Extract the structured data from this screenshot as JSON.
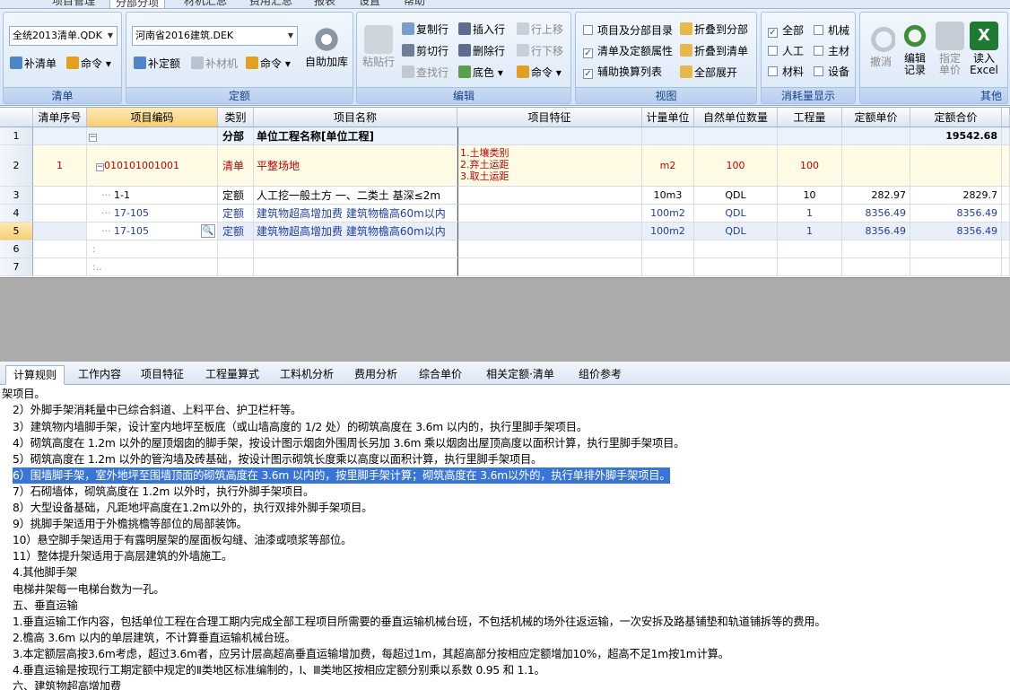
{
  "menu": {
    "items": [
      "项目管理",
      "分部分项",
      "材机汇总",
      "费用汇总",
      "报表",
      "设置",
      "帮助"
    ],
    "active": 1
  },
  "ribbon": {
    "g_qingdan": {
      "title": "清单",
      "combo": "全统2013清单.QDK",
      "btn1": "补清单",
      "btn2": "命令"
    },
    "g_dinge": {
      "title": "定额",
      "combo": "河南省2016建筑.DEK",
      "btn1": "补定额",
      "btn2": "补材机",
      "btn3": "命令",
      "big": "自助加库"
    },
    "g_edit": {
      "title": "编辑",
      "paste": "粘贴行",
      "copy": "复制行",
      "cut": "剪切行",
      "find": "查找行",
      "insert": "插入行",
      "delete": "删除行",
      "bg": "底色",
      "up": "行上移",
      "down": "行下移",
      "cmd": "命令"
    },
    "g_view": {
      "title": "视图",
      "c1": "项目及分部目录",
      "c2": "清单及定额属性",
      "c3": "辅助换算列表",
      "b1": "折叠到分部",
      "b2": "折叠到清单",
      "b3": "全部展开"
    },
    "g_consume": {
      "title": "消耗量显示",
      "c1": "全部",
      "c2": "机械",
      "c3": "人工",
      "c4": "主材",
      "c5": "材料",
      "c6": "设备"
    },
    "g_other": {
      "title": "其他",
      "undo": "撤消",
      "edit_l1": "编辑",
      "edit_l2": "记录",
      "price_l1": "指定",
      "price_l2": "单价",
      "read_l1": "读入",
      "read_l2": "Excel"
    }
  },
  "grid": {
    "headers": [
      "清单序号",
      "项目编码",
      "类别",
      "项目名称",
      "项目特征",
      "计量单位",
      "自然单位数量",
      "工程量",
      "定额单价",
      "定额合价"
    ],
    "rows": [
      {
        "n": "1",
        "seq": "",
        "code": "",
        "type": "分部",
        "name": "单位工程名称[单位工程]",
        "feature": "",
        "unit": "",
        "nat": "",
        "qty": "",
        "price": "",
        "total": "19542.68"
      },
      {
        "n": "2",
        "seq": "1",
        "code": "010101001001",
        "type": "清单",
        "name": "平整场地",
        "feature": [
          "1.土壤类别",
          "2.弃土运距",
          "3.取土运距"
        ],
        "unit": "m2",
        "nat": "100",
        "qty": "100",
        "price": "",
        "total": ""
      },
      {
        "n": "3",
        "seq": "",
        "code": "1-1",
        "type": "定额",
        "name": "人工挖一般土方 一、二类土 基深≤2m",
        "feature": "",
        "unit": "10m3",
        "nat": "QDL",
        "qty": "10",
        "price": "282.97",
        "total": "2829.7"
      },
      {
        "n": "4",
        "seq": "",
        "code": "17-105",
        "type": "定额",
        "name": "建筑物超高增加费 建筑物檐高60m以内",
        "feature": "",
        "unit": "100m2",
        "nat": "QDL",
        "qty": "1",
        "price": "8356.49",
        "total": "8356.49"
      },
      {
        "n": "5",
        "seq": "",
        "code": "17-105",
        "type": "定额",
        "name": "建筑物超高增加费 建筑物檐高60m以内",
        "feature": "",
        "unit": "100m2",
        "nat": "QDL",
        "qty": "1",
        "price": "8356.49",
        "total": "8356.49"
      },
      {
        "n": "6"
      },
      {
        "n": "7"
      }
    ]
  },
  "tabs": [
    "计算规则",
    "工作内容",
    "项目特征",
    "工程量算式",
    "工料机分析",
    "费用分析",
    "综合单价",
    "相关定额·清单",
    "组价参考"
  ],
  "rules": [
    "架项目。",
    "2）外脚手架消耗量中已综合斜道、上料平台、护卫栏杆等。",
    "3）建筑物内墙脚手架，设计室内地坪至板底（或山墙高度的 1/2 处）的砌筑高度在 3.6m 以内的，执行里脚手架项目。",
    "4）砌筑高度在 1.2m 以外的屋顶烟囱的脚手架，按设计图示烟囱外围周长另加 3.6m 乘以烟囱出屋顶高度以面积计算，执行里脚手架项目。",
    "5）砌筑高度在 1.2m 以外的管沟墙及砖基础，按设计图示砌筑长度乘以高度以面积计算，执行里脚手架项目。",
    "6）围墙脚手架，室外地坪至围墙顶面的砌筑高度在 3.6m 以内的，按里脚手架计算；砌筑高度在 3.6m以外的，执行单排外脚手架项目。",
    "7）石砌墙体，砌筑高度在 1.2m 以外时，执行外脚手架项目。",
    "8）大型设备基础，凡距地坪高度在1.2m以外的，执行双排外脚手架项目。",
    "9）挑脚手架适用于外檐挑檐等部位的局部装饰。",
    "10）悬空脚手架适用于有露明屋架的屋面板勾缝、油漆或喷浆等部位。",
    "11）整体提升架适用于高层建筑的外墙施工。",
    "4.其他脚手架",
    "电梯井架每一电梯台数为一孔。",
    "五、垂直运输",
    "1.垂直运输工作内容，包括单位工程在合理工期内完成全部工程项目所需要的垂直运输机械台班，不包括机械的场外往返运输，一次安拆及路基铺垫和轨道铺拆等的费用。",
    "2.檐高 3.6m 以内的单层建筑，不计算垂直运输机械台班。",
    "3.本定额层高按3.6m考虑，超过3.6m者，应另计层高超高垂直运输增加费，每超过1m，其超高部分按相应定额增加10%，超高不足1m按1m计算。",
    "4.垂直运输是按现行工期定额中规定的Ⅱ类地区标准编制的，Ⅰ、Ⅲ类地区按相应定额分别乘以系数 0.95 和 1.1。",
    "六、建筑物超高增加费"
  ]
}
